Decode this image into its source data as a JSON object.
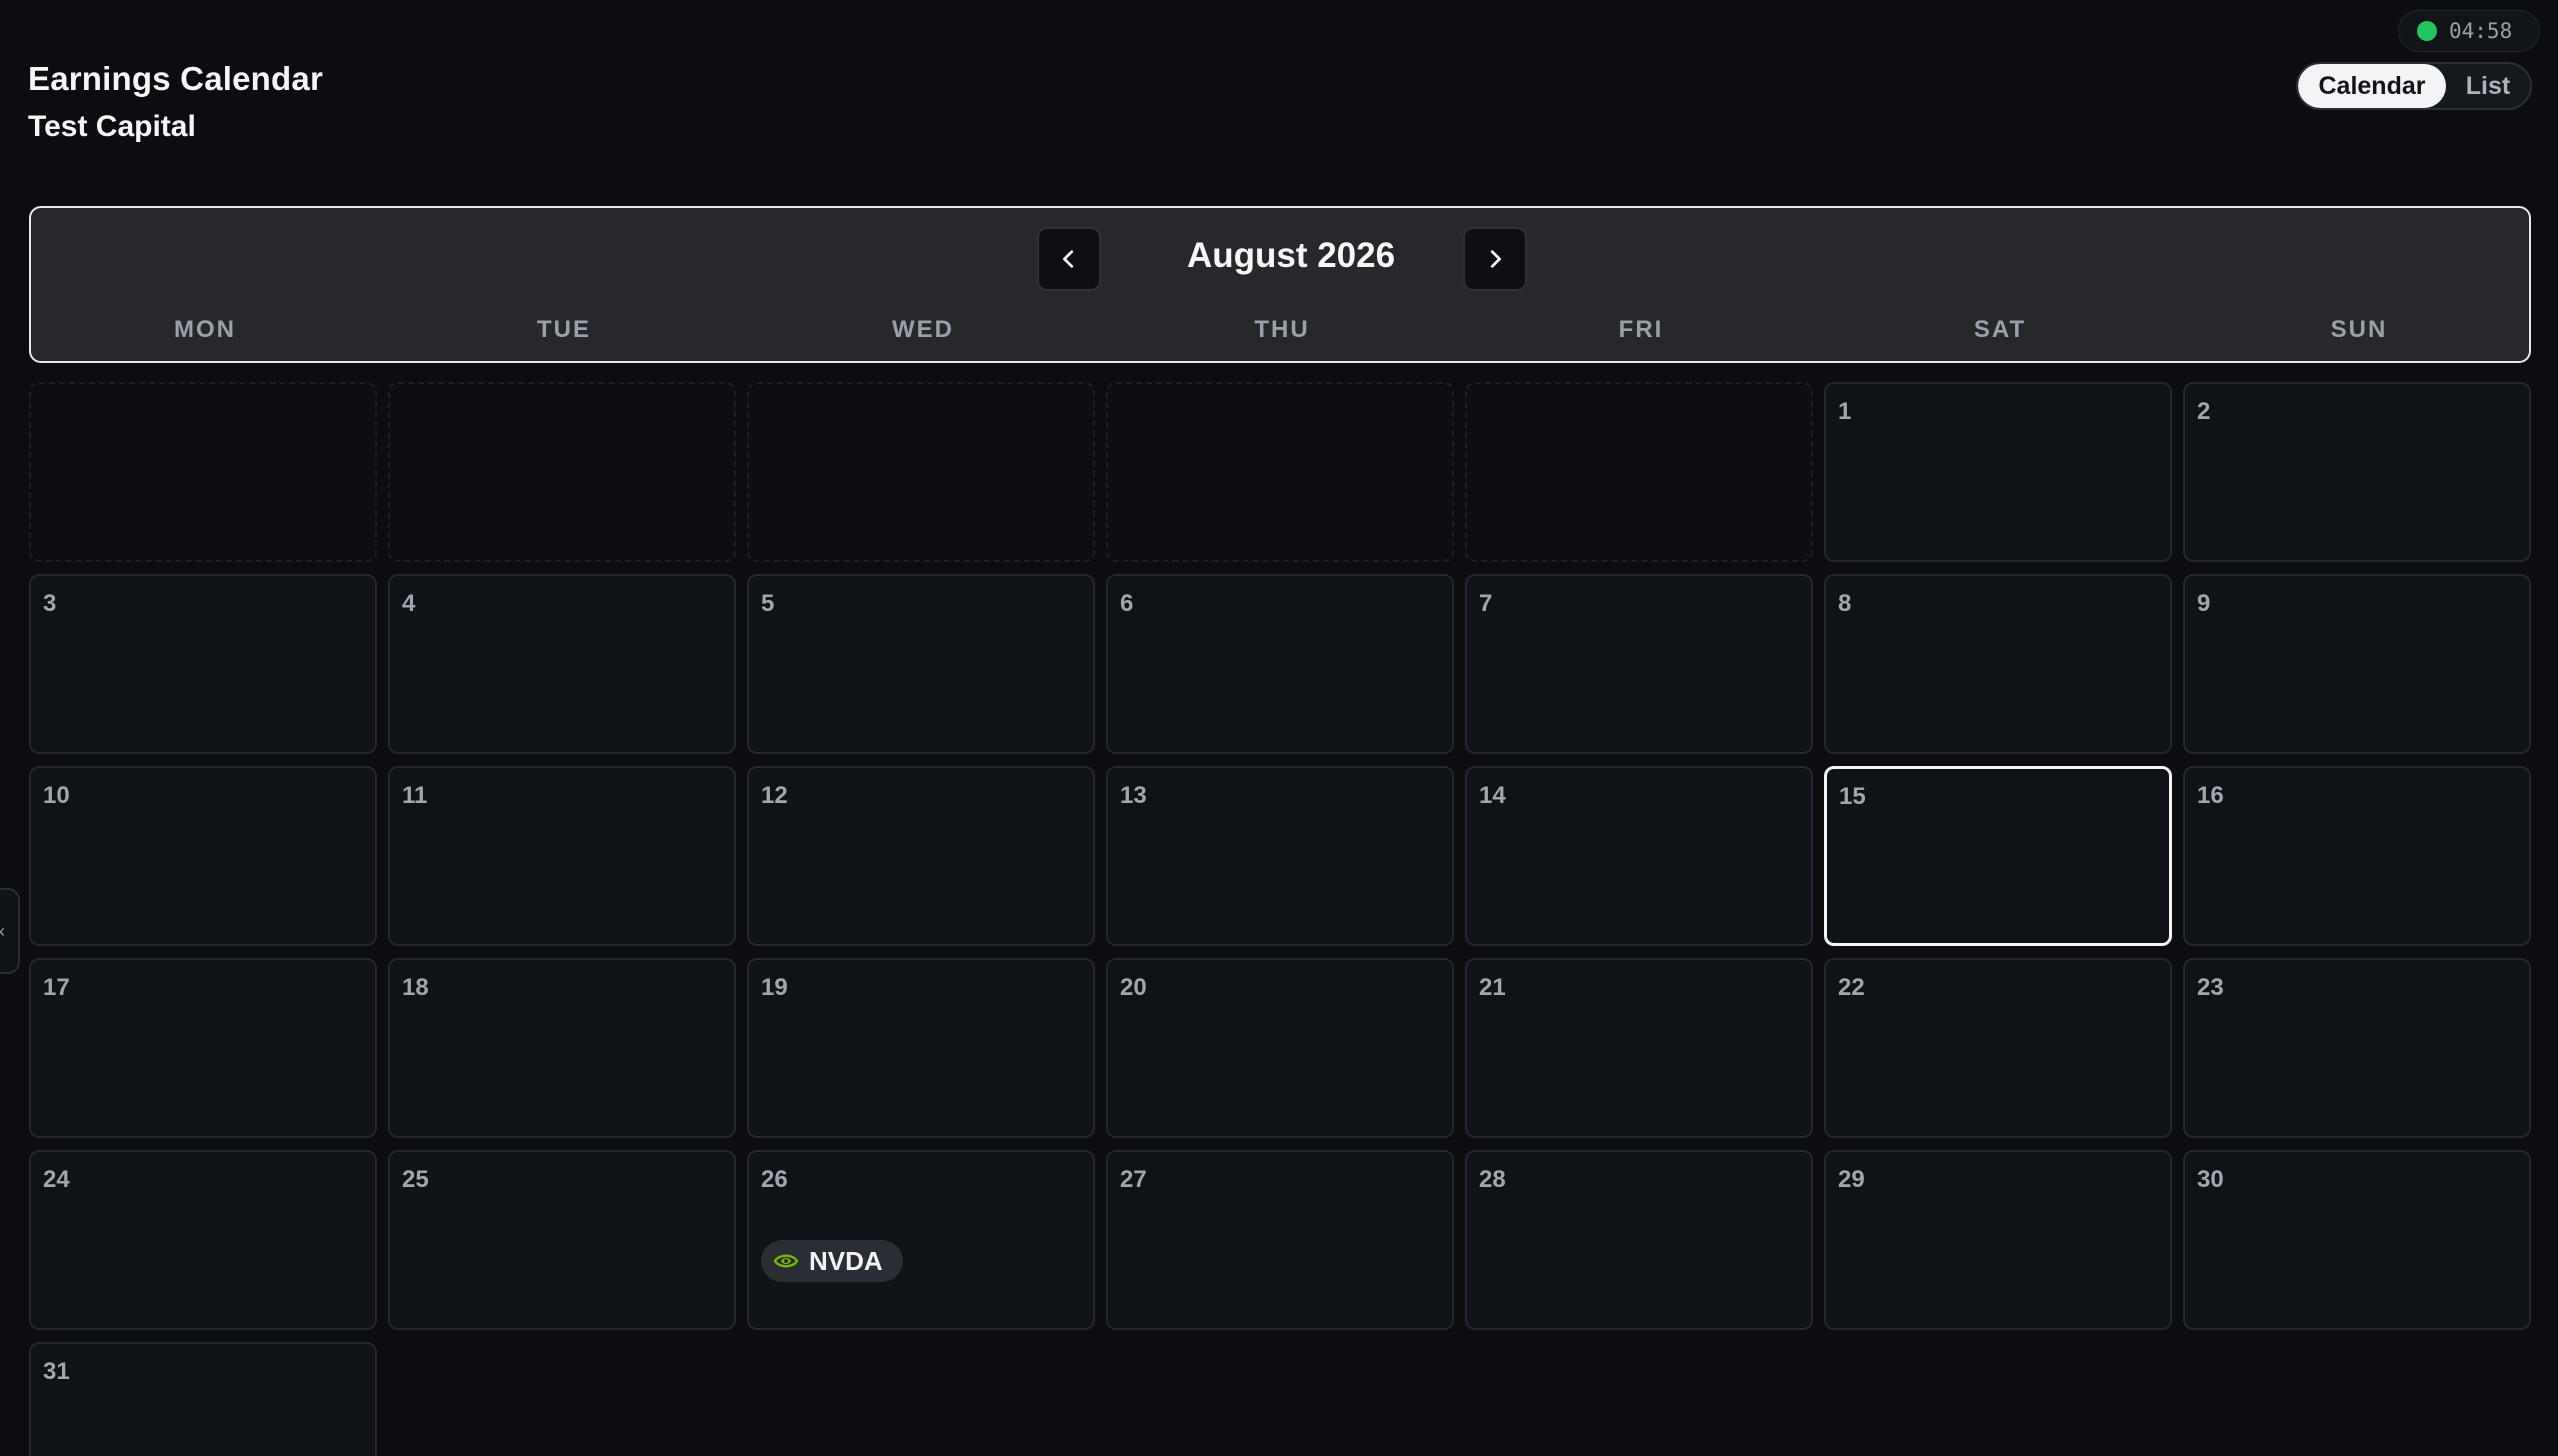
{
  "header": {
    "title": "Earnings Calendar",
    "subtitle": "Test Capital"
  },
  "status": {
    "indicator_color": "#22c55e",
    "time": "04:58"
  },
  "view_toggle": {
    "options": [
      "Calendar",
      "List"
    ],
    "active": "Calendar"
  },
  "calendar": {
    "month_label": "August 2026",
    "prev_icon": "chevron-left-icon",
    "next_icon": "chevron-right-icon",
    "weekdays": [
      "MON",
      "TUE",
      "WED",
      "THU",
      "FRI",
      "SAT",
      "SUN"
    ],
    "leading_blank_days": 5,
    "days_in_month": 31,
    "today": 15,
    "events": [
      {
        "day": 26,
        "ticker": "NVDA",
        "icon": "nvidia-logo-icon",
        "brand_color": "#76b900"
      }
    ]
  },
  "sidebar_handle": {
    "icon": "chevron-left-icon",
    "glyph": "‹"
  }
}
